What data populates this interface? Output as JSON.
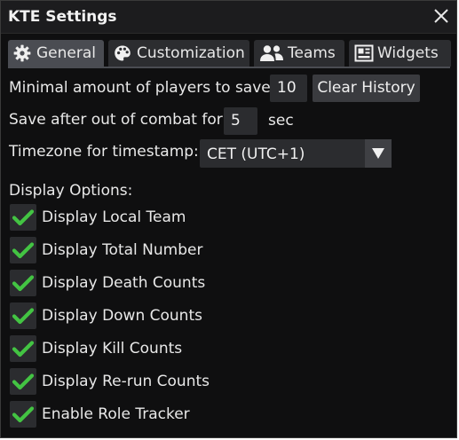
{
  "window": {
    "title": "KTE Settings"
  },
  "tabs": [
    {
      "label": "General",
      "icon": "gear-icon",
      "active": true
    },
    {
      "label": "Customization",
      "icon": "palette-icon",
      "active": false
    },
    {
      "label": "Teams",
      "icon": "users-icon",
      "active": false
    },
    {
      "label": "Widgets",
      "icon": "widgets-icon",
      "active": false
    }
  ],
  "general": {
    "min_players_label": "Minimal amount of players to save:",
    "min_players_value": "10",
    "clear_history_label": "Clear History",
    "save_after_label": "Save after out of combat for:",
    "save_after_value": "5",
    "save_after_unit": "sec",
    "timezone_label": "Timezone for timestamp:",
    "timezone_value": "CET (UTC+1)",
    "display_options_label": "Display Options:",
    "options": [
      {
        "label": "Display Local Team",
        "checked": true
      },
      {
        "label": "Display Total Number",
        "checked": true
      },
      {
        "label": "Display Death Counts",
        "checked": true
      },
      {
        "label": "Display Down Counts",
        "checked": true
      },
      {
        "label": "Display Kill Counts",
        "checked": true
      },
      {
        "label": "Display Re-run Counts",
        "checked": true
      },
      {
        "label": "Enable Role Tracker",
        "checked": true
      }
    ]
  },
  "colors": {
    "background": "#0f0f10",
    "titlebar": "#1c1c1e",
    "active_tab": "#4a4c52",
    "inactive_tab": "#2c2d30",
    "field": "#2b2c2f",
    "check_green": "#43c443"
  }
}
